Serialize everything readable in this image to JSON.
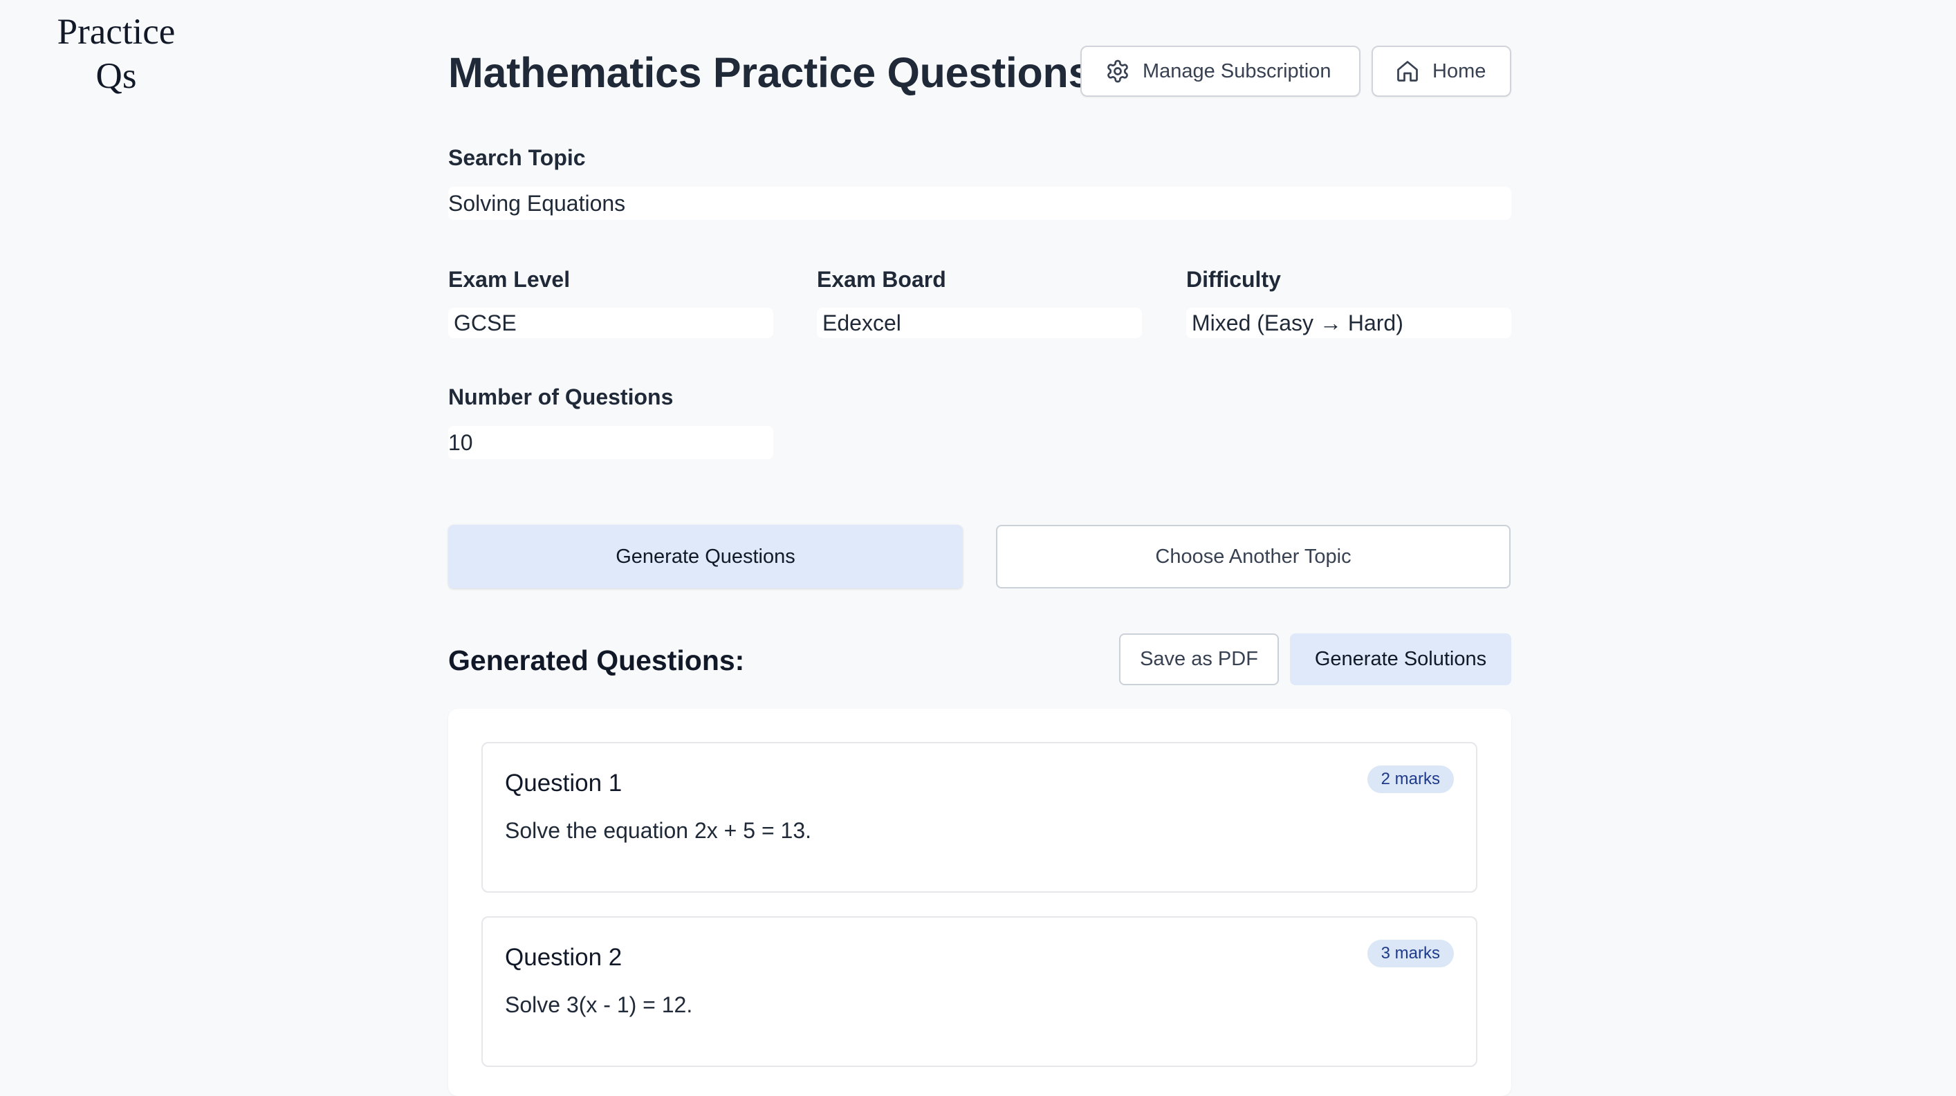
{
  "brand": {
    "logo_line1": "Practice",
    "logo_line2": "Qs"
  },
  "header": {
    "title": "Mathematics Practice Questions",
    "manage_subscription_label": "Manage Subscription",
    "manage_subscription_icon": "gear-icon",
    "home_label": "Home",
    "home_icon": "home-icon"
  },
  "form": {
    "search_topic": {
      "label": "Search Topic",
      "value": "Solving Equations"
    },
    "exam_level": {
      "label": "Exam Level",
      "value": "GCSE"
    },
    "exam_board": {
      "label": "Exam Board",
      "value": "Edexcel"
    },
    "difficulty": {
      "label": "Difficulty",
      "value": "Mixed (Easy → Hard)"
    },
    "num_questions": {
      "label": "Number of Questions",
      "value": "10"
    }
  },
  "actions": {
    "generate_label": "Generate Questions",
    "choose_another_label": "Choose Another Topic"
  },
  "generated": {
    "section_title": "Generated Questions:",
    "save_pdf_label": "Save as PDF",
    "generate_solutions_label": "Generate Solutions",
    "questions": [
      {
        "title": "Question 1",
        "marks": "2 marks",
        "text": "Solve the equation 2x + 5 = 13."
      },
      {
        "title": "Question 2",
        "marks": "3 marks",
        "text": "Solve 3(x - 1) = 12."
      }
    ]
  },
  "colors": {
    "page_background": "#f8f9fb",
    "primary_button": "#dfe9f9",
    "badge_background": "#dbe6f7",
    "badge_text": "#1e3a8a",
    "text_dark": "#1f2937"
  }
}
